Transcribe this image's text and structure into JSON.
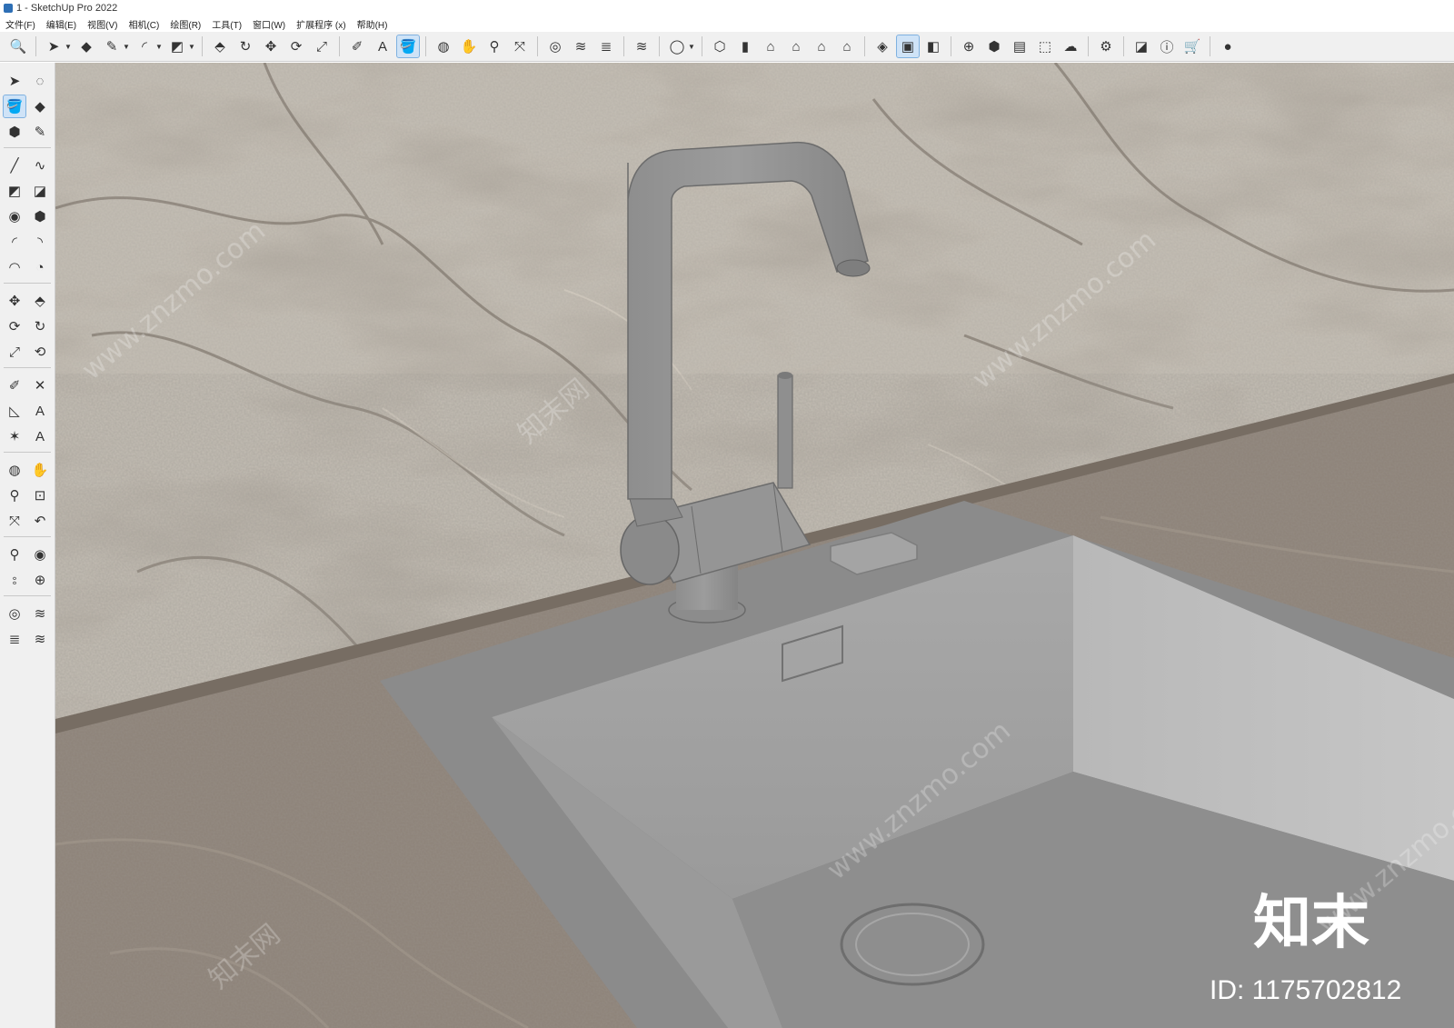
{
  "window": {
    "title": "1 - SketchUp Pro 2022"
  },
  "menu": [
    "文件(F)",
    "编辑(E)",
    "视图(V)",
    "相机(C)",
    "绘图(R)",
    "工具(T)",
    "窗口(W)",
    "扩展程序 (x)",
    "帮助(H)"
  ],
  "toolbar": {
    "icons": [
      {
        "name": "zoom-icon",
        "glyph": "🔍"
      },
      {
        "sep": true
      },
      {
        "name": "select-icon",
        "glyph": "➤",
        "dd": true
      },
      {
        "name": "eraser-icon",
        "glyph": "◆"
      },
      {
        "name": "pencil-icon",
        "glyph": "✎",
        "dd": true
      },
      {
        "name": "arc-icon",
        "glyph": "◜",
        "dd": true
      },
      {
        "name": "rectangle-icon",
        "glyph": "◩",
        "dd": true
      },
      {
        "sep": true
      },
      {
        "name": "push-pull-icon",
        "glyph": "⬘"
      },
      {
        "name": "follow-me-icon",
        "glyph": "↻"
      },
      {
        "name": "move-icon",
        "glyph": "✥"
      },
      {
        "name": "rotate-icon",
        "glyph": "⟳"
      },
      {
        "name": "scale-icon",
        "glyph": "⤢"
      },
      {
        "sep": true
      },
      {
        "name": "tape-measure-icon",
        "glyph": "✐"
      },
      {
        "name": "text-icon",
        "glyph": "A"
      },
      {
        "name": "paint-bucket-icon",
        "glyph": "🪣",
        "active": true
      },
      {
        "sep": true
      },
      {
        "name": "orbit-icon",
        "glyph": "◍"
      },
      {
        "name": "pan-icon",
        "glyph": "✋"
      },
      {
        "name": "zoom-tool-icon",
        "glyph": "⚲"
      },
      {
        "name": "zoom-extents-icon",
        "glyph": "⤧"
      },
      {
        "sep": true
      },
      {
        "name": "warehouse-icon",
        "glyph": "◎"
      },
      {
        "name": "extension-icon",
        "glyph": "≋"
      },
      {
        "name": "layers-icon",
        "glyph": "≣"
      },
      {
        "sep": true
      },
      {
        "name": "send-layout-icon",
        "glyph": "≋"
      },
      {
        "sep": true
      },
      {
        "name": "account-icon",
        "glyph": "◯",
        "dd": true
      },
      {
        "sep": true
      },
      {
        "name": "iso-view-icon",
        "glyph": "⬡"
      },
      {
        "name": "top-view-icon",
        "glyph": "▮"
      },
      {
        "name": "front-view-icon",
        "glyph": "⌂"
      },
      {
        "name": "right-view-icon",
        "glyph": "⌂"
      },
      {
        "name": "back-view-icon",
        "glyph": "⌂"
      },
      {
        "name": "left-view-icon",
        "glyph": "⌂"
      },
      {
        "sep": true
      },
      {
        "name": "solid-tools-icon",
        "glyph": "◈"
      },
      {
        "name": "section-plane-icon",
        "glyph": "▣",
        "active": true
      },
      {
        "name": "section-display-icon",
        "glyph": "◧"
      },
      {
        "sep": true
      },
      {
        "name": "add-location-icon",
        "glyph": "⊕"
      },
      {
        "name": "shadows-icon",
        "glyph": "⬢"
      },
      {
        "name": "styles-icon",
        "glyph": "▤"
      },
      {
        "name": "xray-icon",
        "glyph": "⬚"
      },
      {
        "name": "cloud-icon",
        "glyph": "☁"
      },
      {
        "sep": true
      },
      {
        "name": "settings-icon",
        "glyph": "⚙"
      },
      {
        "sep": true
      },
      {
        "name": "components-icon",
        "glyph": "◪"
      },
      {
        "name": "info-icon",
        "glyph": "ⓘ"
      },
      {
        "name": "cart-icon",
        "glyph": "🛒"
      },
      {
        "sep": true
      },
      {
        "name": "user-icon",
        "glyph": "●"
      }
    ]
  },
  "palette": {
    "rows": [
      [
        {
          "name": "select-icon",
          "glyph": "➤"
        },
        {
          "name": "lasso-icon",
          "glyph": "◌"
        }
      ],
      [
        {
          "name": "paint-bucket-icon",
          "glyph": "🪣",
          "active": true
        },
        {
          "name": "eraser-icon",
          "glyph": "◆"
        }
      ],
      [
        {
          "name": "component-icon",
          "glyph": "⬢"
        },
        {
          "name": "tag-icon",
          "glyph": "✎"
        }
      ],
      "sep",
      [
        {
          "name": "line-icon",
          "glyph": "╱"
        },
        {
          "name": "freehand-icon",
          "glyph": "∿"
        }
      ],
      [
        {
          "name": "rectangle-icon",
          "glyph": "◩"
        },
        {
          "name": "rotated-rectangle-icon",
          "glyph": "◪"
        }
      ],
      [
        {
          "name": "circle-icon",
          "glyph": "◉"
        },
        {
          "name": "polygon-icon",
          "glyph": "⬢"
        }
      ],
      [
        {
          "name": "arc-icon",
          "glyph": "◜"
        },
        {
          "name": "two-point-arc-icon",
          "glyph": "◝"
        }
      ],
      [
        {
          "name": "three-point-arc-icon",
          "glyph": "◠"
        },
        {
          "name": "pie-icon",
          "glyph": "◔"
        }
      ],
      "sep",
      [
        {
          "name": "move-icon",
          "glyph": "✥"
        },
        {
          "name": "push-pull-icon",
          "glyph": "⬘"
        }
      ],
      [
        {
          "name": "rotate-icon",
          "glyph": "⟳"
        },
        {
          "name": "follow-me-icon",
          "glyph": "↻"
        }
      ],
      [
        {
          "name": "scale-icon",
          "glyph": "⤢"
        },
        {
          "name": "offset-icon",
          "glyph": "⟲"
        }
      ],
      "sep",
      [
        {
          "name": "tape-measure-icon",
          "glyph": "✐"
        },
        {
          "name": "dimension-icon",
          "glyph": "✕"
        }
      ],
      [
        {
          "name": "protractor-icon",
          "glyph": "◺"
        },
        {
          "name": "text-icon",
          "glyph": "A"
        }
      ],
      [
        {
          "name": "axes-icon",
          "glyph": "✶"
        },
        {
          "name": "3d-text-icon",
          "glyph": "A"
        }
      ],
      "sep",
      [
        {
          "name": "orbit-icon",
          "glyph": "◍"
        },
        {
          "name": "pan-icon",
          "glyph": "✋"
        }
      ],
      [
        {
          "name": "zoom-icon",
          "glyph": "⚲"
        },
        {
          "name": "zoom-window-icon",
          "glyph": "⊡"
        }
      ],
      [
        {
          "name": "zoom-extents-icon",
          "glyph": "⤧"
        },
        {
          "name": "previous-view-icon",
          "glyph": "↶"
        }
      ],
      "sep",
      [
        {
          "name": "position-camera-icon",
          "glyph": "⚲"
        },
        {
          "name": "look-around-icon",
          "glyph": "◉"
        }
      ],
      [
        {
          "name": "walk-icon",
          "glyph": "⦂"
        },
        {
          "name": "section-plane-icon",
          "glyph": "⊕"
        }
      ],
      "sep",
      [
        {
          "name": "warehouse-icon",
          "glyph": "◎"
        },
        {
          "name": "extension-icon",
          "glyph": "≋"
        }
      ],
      [
        {
          "name": "layers-icon",
          "glyph": "≣"
        },
        {
          "name": "send-layout-icon",
          "glyph": "≋"
        }
      ]
    ]
  },
  "watermark": {
    "brand": "知末",
    "id": "ID: 1175702812",
    "site": "www.znzmo.com",
    "cn": "知末网"
  }
}
